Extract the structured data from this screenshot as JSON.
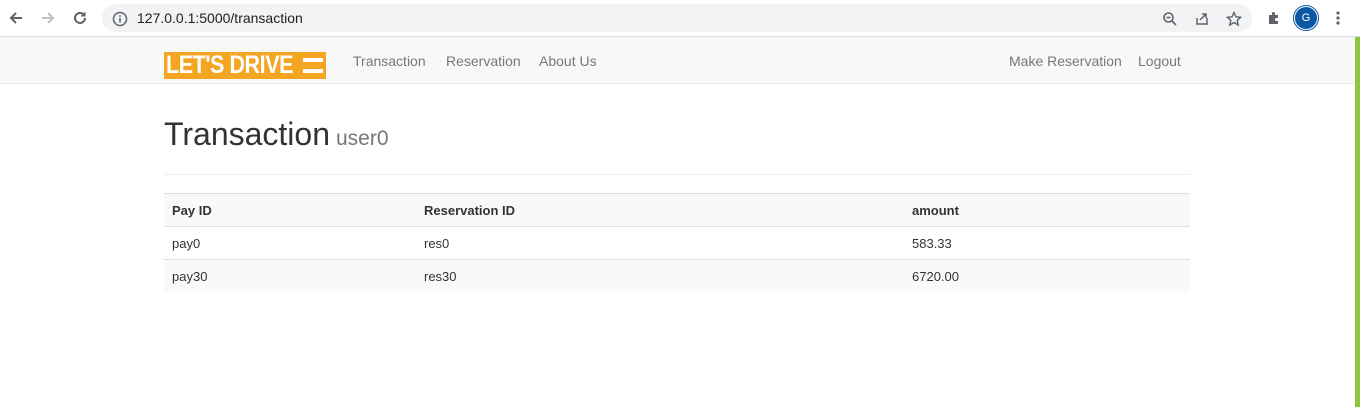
{
  "browser": {
    "url": "127.0.0.1:5000/transaction",
    "avatar_initial": "G",
    "icons": [
      "back-icon",
      "forward-icon",
      "reload-icon",
      "info-icon",
      "zoom-icon",
      "share-icon",
      "star-icon",
      "extensions-icon",
      "more-icon"
    ]
  },
  "navbar": {
    "brand": "LET'S DRIVE",
    "links": {
      "transaction": "Transaction",
      "reservation": "Reservation",
      "about": "About Us",
      "make_reservation": "Make Reservation",
      "logout": "Logout"
    }
  },
  "page": {
    "title": "Transaction",
    "subtitle": "user0"
  },
  "table": {
    "headers": [
      "Pay ID",
      "Reservation ID",
      "amount"
    ],
    "rows": [
      [
        "pay0",
        "res0",
        "583.33"
      ],
      [
        "pay30",
        "res30",
        "6720.00"
      ]
    ]
  },
  "colors": {
    "brand": "#f4a623",
    "accent_bar": "#8dc63f",
    "avatar": "#0b57a4"
  }
}
